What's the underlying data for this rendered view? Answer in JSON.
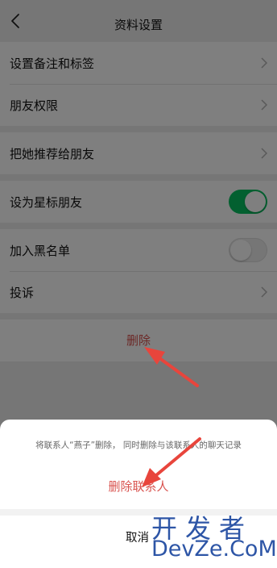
{
  "navbar": {
    "title": "资料设置"
  },
  "group1": {
    "items": [
      {
        "label": "设置备注和标签"
      },
      {
        "label": "朋友权限"
      }
    ]
  },
  "group2": {
    "items": [
      {
        "label": "把她推荐给朋友"
      }
    ]
  },
  "group3": {
    "items": [
      {
        "label": "设为星标朋友",
        "toggle": "on"
      }
    ]
  },
  "group4": {
    "items": [
      {
        "label": "加入黑名单",
        "toggle": "off"
      },
      {
        "label": "投诉"
      }
    ]
  },
  "delete": {
    "label": "删除"
  },
  "sheet": {
    "message": "将联系人“燕子”删除， 同时删除与该联系人的聊天记录",
    "confirm_label": "删除联系人",
    "cancel_label": "取消"
  },
  "watermark": {
    "line1": "开发者",
    "line2": "DevZe.CoM"
  },
  "colors": {
    "accent_green": "#07c160",
    "danger_red": "#d9534f",
    "annotation_red": "#e8453c",
    "watermark_blue": "#2d55a6"
  }
}
